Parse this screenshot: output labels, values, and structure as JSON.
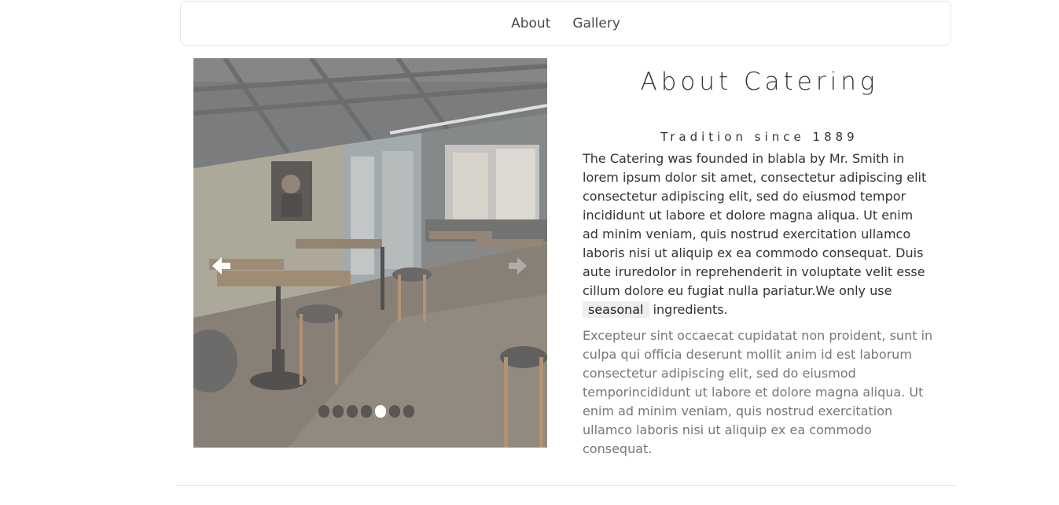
{
  "nav": {
    "items": [
      {
        "label": "About"
      },
      {
        "label": "Gallery"
      }
    ]
  },
  "carousel": {
    "slide_count": 7,
    "active_index": 4,
    "left_icon": "arrow-left-icon",
    "right_icon": "arrow-right-icon"
  },
  "about": {
    "title": "About Catering",
    "subtitle": "Tradition since 1889",
    "paragraph_main": "The Catering was founded in blabla by Mr. Smith in\nlorem ipsum dolor sit amet, consectetur adipiscing elit\nconsectetur adipiscing elit, sed do eiusmod tempor\nincididunt ut labore et dolore magna aliqua. Ut enim\nad minim veniam, quis nostrud exercitation ullamco\nlaboris nisi ut aliquip ex ea commodo consequat. Duis\naute iruredolor in reprehenderit in voluptate velit esse\ncillum dolore eu fugiat nulla pariatur.We only use\n",
    "highlight": "seasonal",
    "paragraph_tail": " ingredients.",
    "paragraph_muted": "Excepteur sint occaecat cupidatat non proident, sunt in\nculpa qui officia deserunt mollit anim id est laborum\nconsectetur adipiscing elit, sed do eiusmod\ntemporincididunt ut labore et dolore magna aliqua. Ut\nenim ad minim veniam, quis nostrud exercitation\nullamco laboris nisi ut aliquip ex ea commodo\nconsequat."
  },
  "colors": {
    "text": "#333333",
    "muted": "#777777",
    "highlight_bg": "#eeeeee"
  }
}
